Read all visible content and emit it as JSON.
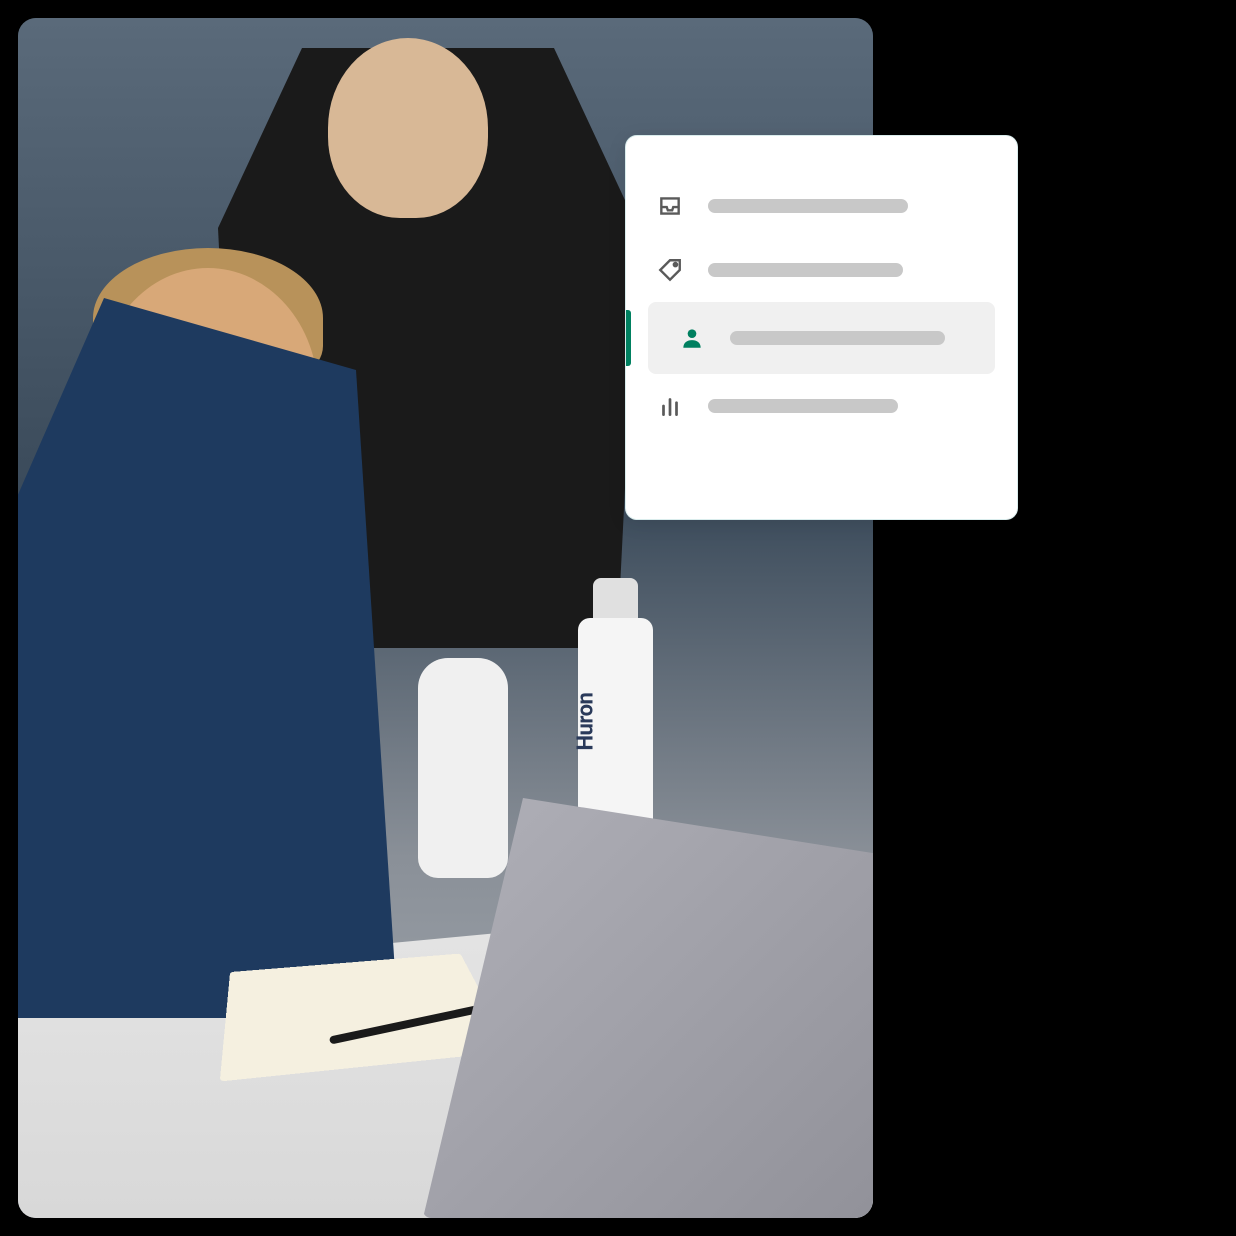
{
  "photo": {
    "description": "Two men at a desk reviewing products with a laptop",
    "product_brand": "Huron"
  },
  "ui_panel": {
    "items": [
      {
        "icon": "inbox",
        "active": false
      },
      {
        "icon": "tag",
        "active": false
      },
      {
        "icon": "person",
        "active": true
      },
      {
        "icon": "analytics",
        "active": false
      }
    ],
    "colors": {
      "accent": "#008060",
      "placeholder": "#c8c8c8",
      "active_bg": "#f0f0f0"
    }
  }
}
